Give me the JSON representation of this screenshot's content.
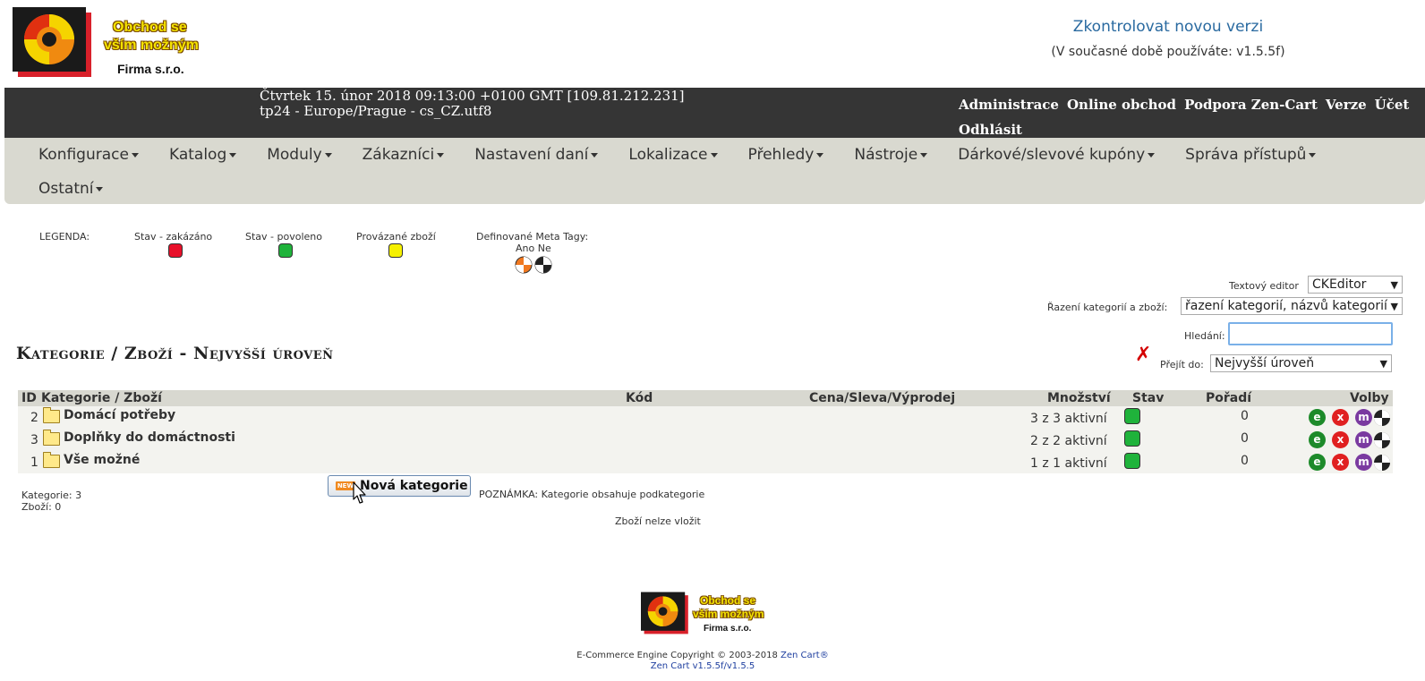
{
  "logo": {
    "line1": "Obchod se",
    "line2": "vším možným",
    "line3": "Firma s.r.o."
  },
  "version": {
    "link": "Zkontrolovat novou verzi",
    "current": "(V současné době používáte: v1.5.5f)"
  },
  "topbar": {
    "datetime": "Čtvrtek 15. únor 2018 09:13:00 +0100 GMT [109.81.212.231]",
    "locale": "tp24 - Europe/Prague - cs_CZ.utf8",
    "nav": [
      "Administrace",
      "Online obchod",
      "Podpora Zen-Cart",
      "Verze",
      "Účet",
      "Odhlásit"
    ]
  },
  "menu": {
    "row1": [
      "Konfigurace",
      "Katalog",
      "Moduly",
      "Zákazníci",
      "Nastavení daní",
      "Lokalizace",
      "Přehledy",
      "Nástroje",
      "Dárkové/slevové kupóny",
      "Správa přístupů"
    ],
    "row2": [
      "Ostatní"
    ]
  },
  "legend": {
    "title": "LEGENDA:",
    "disabled": "Stav - zakázáno",
    "enabled": "Stav - povoleno",
    "linked": "Provázané zboží",
    "meta": "Definované Meta Tagy:",
    "meta_yesno": "Ano Ne",
    "colors": {
      "disabled": "#e8102a",
      "enabled": "#1fb33b",
      "linked": "#f5f000"
    }
  },
  "controls": {
    "editor_label": "Textový editor",
    "editor_value": "CKEditor",
    "sort_label": "Řazení kategorií a zboží:",
    "sort_value": "řazení kategorií, názvů kategorií",
    "search_label": "Hledání:",
    "search_value": "",
    "goto_label": "Přejít do:",
    "goto_value": "Nejvyšší úroveň"
  },
  "page_title": "Kategorie / Zboží - Nejvyšší úroveň",
  "table": {
    "headers": {
      "id": "ID",
      "name": "Kategorie / Zboží",
      "code": "Kód",
      "price": "Cena/Sleva/Výprodej",
      "qty": "Množství",
      "status": "Stav",
      "order": "Pořadí",
      "options": "Volby"
    },
    "rows": [
      {
        "id": "2",
        "name": "Domácí potřeby",
        "qty": "3 z 3 aktivní",
        "order": "0"
      },
      {
        "id": "3",
        "name": "Doplňky do domáctnosti",
        "qty": "2 z 2 aktivní",
        "order": "0"
      },
      {
        "id": "1",
        "name": "Vše možné",
        "qty": "1 z 1 aktivní",
        "order": "0"
      }
    ],
    "icon_letters": {
      "edit": "e",
      "delete": "x",
      "move": "m"
    }
  },
  "summary": {
    "categories": "Kategorie: 3",
    "products": "Zboží: 0"
  },
  "new_category": {
    "badge": "NEW",
    "label": "Nová kategorie"
  },
  "note": "POZNÁMKA: Kategorie obsahuje podkategorie",
  "no_insert": "Zboží nelze vložit",
  "footer": {
    "copyright": "E-Commerce Engine Copyright © 2003-2018",
    "zencart": "Zen Cart®",
    "version": "Zen Cart v1.5.5f/v1.5.5"
  }
}
